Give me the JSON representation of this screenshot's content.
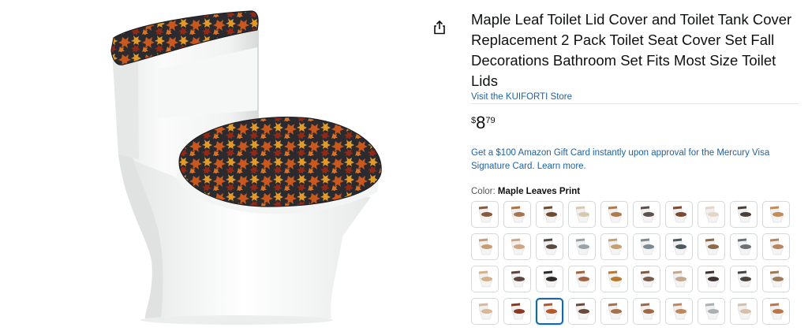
{
  "product": {
    "title": "Maple Leaf Toilet Lid Cover and Toilet Tank Cover Replacement 2 Pack Toilet Seat Cover Set Fall Decorations Bathroom Set Fits Most Size Toilet Lids",
    "store_link": "Visit the KUIFORTI Store",
    "price": {
      "symbol": "$",
      "whole": "8",
      "fraction": "79"
    },
    "promo": "Get a $100 Amazon Gift Card instantly upon approval for the Mercury Visa Signature Card. Learn more.",
    "color_label": "Color:",
    "color_value": "Maple Leaves Print"
  },
  "image": {
    "main_alt": "Toilet with maple leaf print lid cover and tank cover",
    "icon": "share-icon"
  },
  "colors": {
    "leaf_orange": "#c8581e",
    "leaf_gold": "#e09a2c",
    "leaf_red": "#8e2a17",
    "fabric_dark": "#2b2a2e",
    "link": "#2162a1"
  },
  "swatches": {
    "selected_index": 32,
    "patterns": [
      "#8a5a3c",
      "#a8744e",
      "#6e4a2e",
      "#d8c8b0",
      "#b07a4a",
      "#5e5048",
      "#7a4a30",
      "#e4d6c6",
      "#4a4038",
      "#c08c5a",
      "#c89c72",
      "#d2a582",
      "#5a4a40",
      "#9aa2aa",
      "#c4a070",
      "#7c8a94",
      "#4e5a62",
      "#8a6a48",
      "#6a7074",
      "#b8845c",
      "#d6b08a",
      "#5c4840",
      "#2e2a28",
      "#a06440",
      "#b8782e",
      "#7a5a44",
      "#c4a890",
      "#3e3430",
      "#4a4440",
      "#9a7a5a",
      "#d8b898",
      "#8a3a20",
      "#b8582a",
      "#6a4a3a",
      "#a87048",
      "#9c6a44",
      "#c08858",
      "#a8b0b4",
      "#d8c0a8",
      "#b8784a"
    ]
  }
}
